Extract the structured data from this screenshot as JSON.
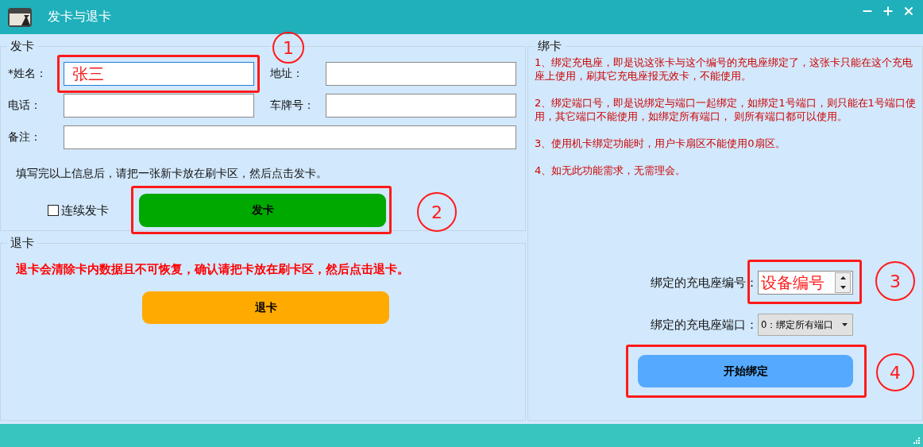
{
  "window": {
    "title": "发卡与退卡"
  },
  "issue_card": {
    "title": "发卡",
    "fields": [
      {
        "label": "*姓名：",
        "value": "张三",
        "focused": true
      },
      {
        "label": "地址：",
        "focused": false
      },
      {
        "label": "电话：",
        "focused": false
      },
      {
        "label": "车牌号：",
        "focused": false
      },
      {
        "label": "备注：",
        "focused": false
      }
    ],
    "hint": "填写完以上信息后，请把一张新卡放在刷卡区，然后点击发卡。",
    "continuous": {
      "label": "连续发卡",
      "checked": false
    },
    "button": "发卡"
  },
  "return_card": {
    "title": "退卡",
    "warning": "退卡会清除卡内数据且不可恢复，确认请把卡放在刷卡区，然后点击退卡。",
    "button": "退卡"
  },
  "bind_card": {
    "title": "绑卡",
    "notes": [
      "1、绑定充电座，即是说这张卡与这个编号的充电座绑定了，这张卡只能在这个充电座上使用，刷其它充电座报无效卡，不能使用。",
      "2、绑定端口号，即是说绑定与端口一起绑定，如绑定1号端口，则只能在1号端口使用，其它端口不能使用，如绑定所有端口， 则所有端口都可以使用。",
      "3、使用机卡绑定功能时，用户卡扇区不能使用0扇区。",
      "4、如无此功能需求，无需理会。"
    ],
    "device_number": {
      "label": "绑定的充电座编号：",
      "value": "设备编号"
    },
    "port": {
      "label": "绑定的充电座端口：",
      "value": "0：绑定所有端口"
    },
    "button": "开始绑定"
  },
  "markers": [
    "1",
    "2",
    "3",
    "4"
  ]
}
